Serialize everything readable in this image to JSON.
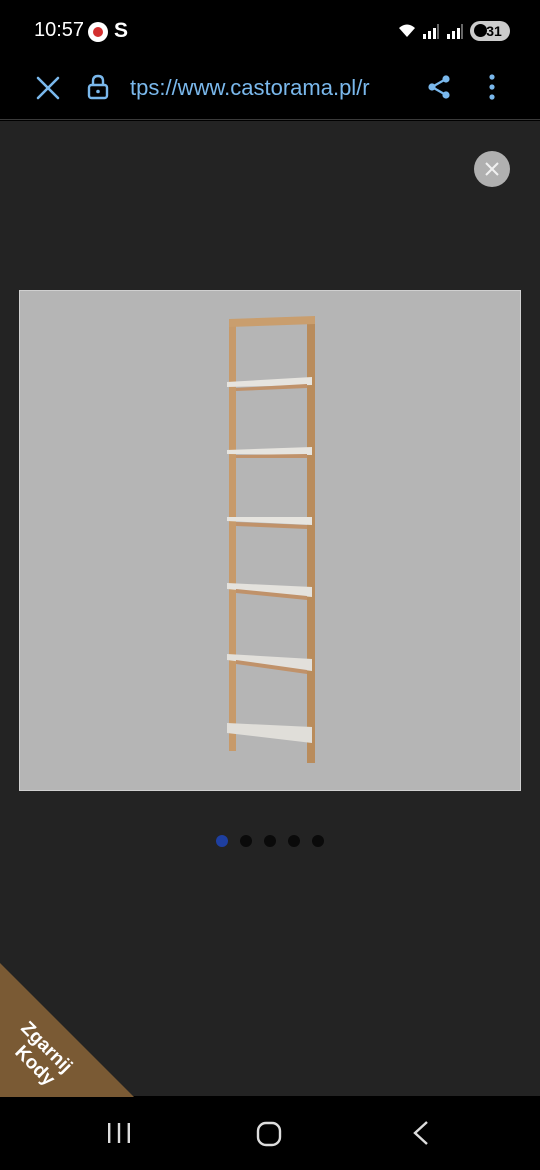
{
  "status_bar": {
    "time": "10:57",
    "carrier_glyph": "S",
    "battery_level": "31",
    "icons": [
      "app-notification-icon",
      "wifi-icon",
      "signal-icon",
      "signal-icon",
      "battery-icon"
    ]
  },
  "browser": {
    "url": "tps://www.castorama.pl/r",
    "url_color": "#7ab8ec",
    "icons": [
      "close-icon",
      "lock-icon",
      "share-icon",
      "more-vert-icon"
    ]
  },
  "gallery": {
    "image_count": 5,
    "active_index": 0,
    "active_dot_color": "#1e3fa0",
    "image_description_icon": "ladder-shelf-product",
    "shelf_count": 6
  },
  "promo": {
    "line1": "Zgarnij",
    "line2": "Kody",
    "color": "#7a5a34"
  },
  "nav": {
    "icons": [
      "recents-icon",
      "home-icon",
      "back-icon"
    ]
  }
}
